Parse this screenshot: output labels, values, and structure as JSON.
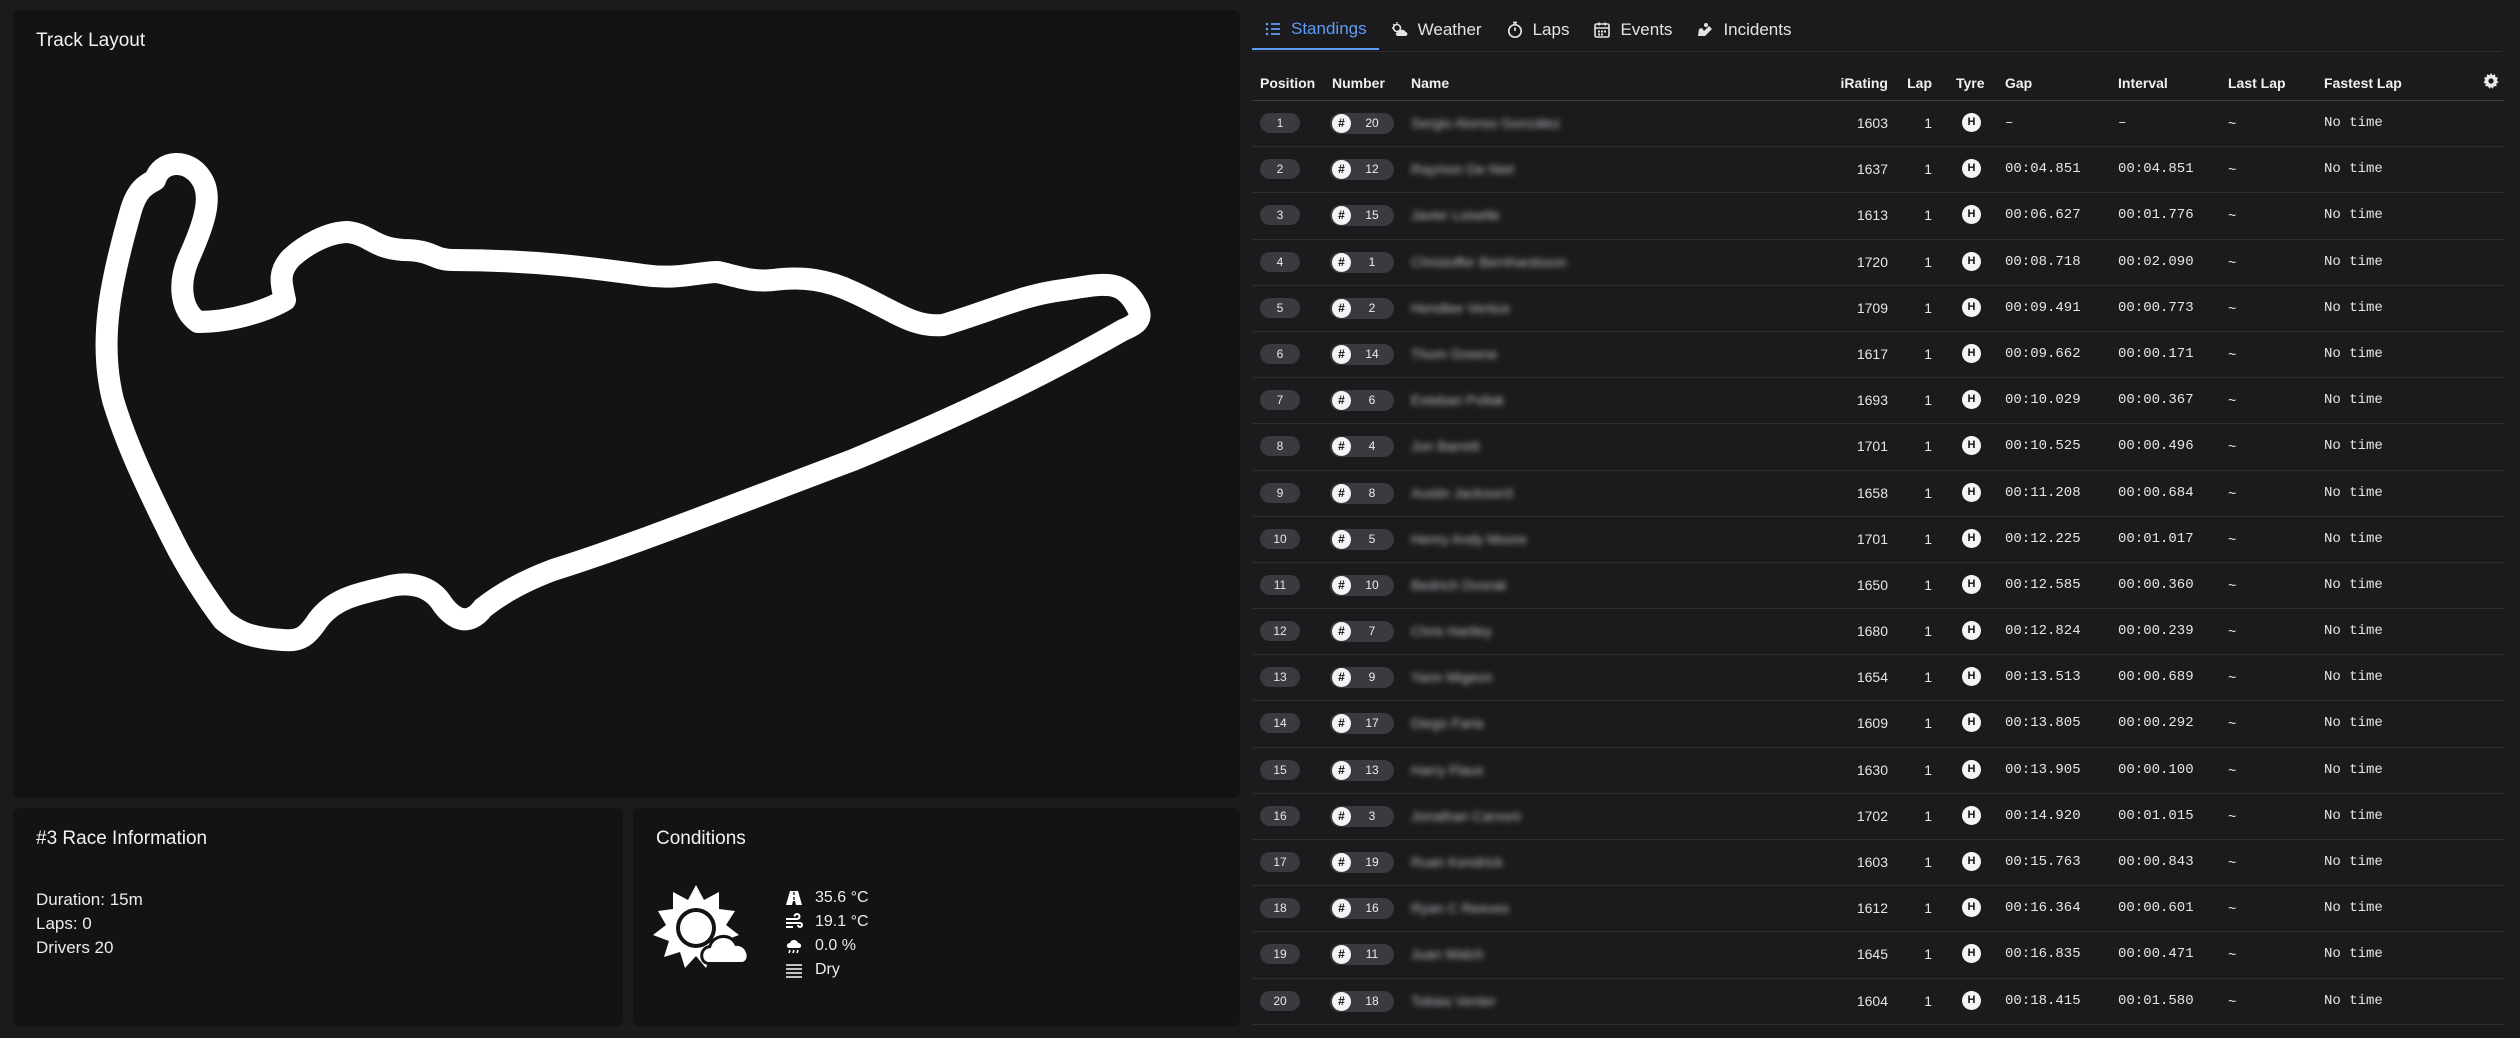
{
  "track_panel": {
    "title": "Track Layout"
  },
  "race_info": {
    "title": "#3 Race Information",
    "duration": "Duration: 15m",
    "laps": "Laps: 0",
    "drivers": "Drivers 20"
  },
  "conditions": {
    "title": "Conditions",
    "weather_icon": "sun-cloud-icon",
    "items": [
      {
        "icon": "road-icon",
        "value": "35.6 °C"
      },
      {
        "icon": "wind-icon",
        "value": "19.1 °C"
      },
      {
        "icon": "rain-cloud-icon",
        "value": "0.0 %"
      },
      {
        "icon": "fog-icon",
        "value": "Dry"
      }
    ]
  },
  "tabs": [
    {
      "label": "Standings",
      "icon": "list-icon",
      "active": true
    },
    {
      "label": "Weather",
      "icon": "weather-icon"
    },
    {
      "label": "Laps",
      "icon": "stopwatch-icon"
    },
    {
      "label": "Events",
      "icon": "calendar-icon"
    },
    {
      "label": "Incidents",
      "icon": "incident-icon"
    }
  ],
  "table": {
    "headers": {
      "position": "Position",
      "number": "Number",
      "name": "Name",
      "irating": "iRating",
      "lap": "Lap",
      "tyre": "Tyre",
      "gap": "Gap",
      "interval": "Interval",
      "last_lap": "Last Lap",
      "fastest_lap": "Fastest Lap"
    },
    "hash": "#",
    "tyre_label": "H",
    "accent": "#5f9cf5",
    "rows": [
      {
        "pos": "1",
        "num": "20",
        "name": "Sergio Alonso González",
        "irating": "1603",
        "lap": "1",
        "gap": "–",
        "interval": "–",
        "last": "~",
        "fastest": "No time"
      },
      {
        "pos": "2",
        "num": "12",
        "name": "Raymon De Niet",
        "irating": "1637",
        "lap": "1",
        "gap": "00:04.851",
        "interval": "00:04.851",
        "last": "~",
        "fastest": "No time"
      },
      {
        "pos": "3",
        "num": "15",
        "name": "Javier Loiselle",
        "irating": "1613",
        "lap": "1",
        "gap": "00:06.627",
        "interval": "00:01.776",
        "last": "~",
        "fastest": "No time"
      },
      {
        "pos": "4",
        "num": "1",
        "name": "Christoffer Bernhardsson",
        "irating": "1720",
        "lap": "1",
        "gap": "00:08.718",
        "interval": "00:02.090",
        "last": "~",
        "fastest": "No time"
      },
      {
        "pos": "5",
        "num": "2",
        "name": "Hendlee Ventus",
        "irating": "1709",
        "lap": "1",
        "gap": "00:09.491",
        "interval": "00:00.773",
        "last": "~",
        "fastest": "No time"
      },
      {
        "pos": "6",
        "num": "14",
        "name": "Thom Greene",
        "irating": "1617",
        "lap": "1",
        "gap": "00:09.662",
        "interval": "00:00.171",
        "last": "~",
        "fastest": "No time"
      },
      {
        "pos": "7",
        "num": "6",
        "name": "Esteban Pollak",
        "irating": "1693",
        "lap": "1",
        "gap": "00:10.029",
        "interval": "00:00.367",
        "last": "~",
        "fastest": "No time"
      },
      {
        "pos": "8",
        "num": "4",
        "name": "Jon Barrett",
        "irating": "1701",
        "lap": "1",
        "gap": "00:10.525",
        "interval": "00:00.496",
        "last": "~",
        "fastest": "No time"
      },
      {
        "pos": "9",
        "num": "8",
        "name": "Austin Jackson3",
        "irating": "1658",
        "lap": "1",
        "gap": "00:11.208",
        "interval": "00:00.684",
        "last": "~",
        "fastest": "No time"
      },
      {
        "pos": "10",
        "num": "5",
        "name": "Henry Andy Moore",
        "irating": "1701",
        "lap": "1",
        "gap": "00:12.225",
        "interval": "00:01.017",
        "last": "~",
        "fastest": "No time"
      },
      {
        "pos": "11",
        "num": "10",
        "name": "Bedrich Dvorak",
        "irating": "1650",
        "lap": "1",
        "gap": "00:12.585",
        "interval": "00:00.360",
        "last": "~",
        "fastest": "No time"
      },
      {
        "pos": "12",
        "num": "7",
        "name": "Chris Hartley",
        "irating": "1680",
        "lap": "1",
        "gap": "00:12.824",
        "interval": "00:00.239",
        "last": "~",
        "fastest": "No time"
      },
      {
        "pos": "13",
        "num": "9",
        "name": "Yann Migeon",
        "irating": "1654",
        "lap": "1",
        "gap": "00:13.513",
        "interval": "00:00.689",
        "last": "~",
        "fastest": "No time"
      },
      {
        "pos": "14",
        "num": "17",
        "name": "Diego Faria",
        "irating": "1609",
        "lap": "1",
        "gap": "00:13.805",
        "interval": "00:00.292",
        "last": "~",
        "fastest": "No time"
      },
      {
        "pos": "15",
        "num": "13",
        "name": "Harry Flaus",
        "irating": "1630",
        "lap": "1",
        "gap": "00:13.905",
        "interval": "00:00.100",
        "last": "~",
        "fastest": "No time"
      },
      {
        "pos": "16",
        "num": "3",
        "name": "Jonathan Carvoni",
        "irating": "1702",
        "lap": "1",
        "gap": "00:14.920",
        "interval": "00:01.015",
        "last": "~",
        "fastest": "No time"
      },
      {
        "pos": "17",
        "num": "19",
        "name": "Ruan Kendrick",
        "irating": "1603",
        "lap": "1",
        "gap": "00:15.763",
        "interval": "00:00.843",
        "last": "~",
        "fastest": "No time"
      },
      {
        "pos": "18",
        "num": "16",
        "name": "Ryan C Reeves",
        "irating": "1612",
        "lap": "1",
        "gap": "00:16.364",
        "interval": "00:00.601",
        "last": "~",
        "fastest": "No time"
      },
      {
        "pos": "19",
        "num": "11",
        "name": "Juan Walch",
        "irating": "1645",
        "lap": "1",
        "gap": "00:16.835",
        "interval": "00:00.471",
        "last": "~",
        "fastest": "No time"
      },
      {
        "pos": "20",
        "num": "18",
        "name": "Tobias Venter",
        "irating": "1604",
        "lap": "1",
        "gap": "00:18.415",
        "interval": "00:01.580",
        "last": "~",
        "fastest": "No time"
      }
    ]
  }
}
